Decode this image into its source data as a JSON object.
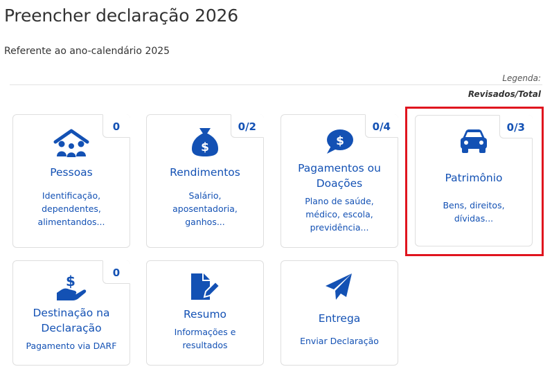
{
  "page": {
    "title": "Preencher declaração 2026",
    "subtitle": "Referente ao ano-calendário 2025",
    "legend_label": "Legenda:",
    "legend_value": "Revisados/Total"
  },
  "colors": {
    "accent": "#1351b4",
    "highlight": "#e0141e",
    "border": "#dedede"
  },
  "cards": [
    {
      "title": "Pessoas",
      "desc": "Identificação, dependentes, alimentandos...",
      "badge": "0",
      "icon": "family-house-icon"
    },
    {
      "title": "Rendimentos",
      "desc": "Salário, aposentadoria, ganhos...",
      "badge": "0/2",
      "icon": "money-bag-icon"
    },
    {
      "title": "Pagamentos ou Doações",
      "desc": "Plano de saúde, médico, escola, previdência...",
      "badge": "0/4",
      "icon": "dollar-chat-bubble-icon"
    },
    {
      "title": "Patrimônio",
      "desc": "Bens, direitos, dívidas...",
      "badge": "0/3",
      "icon": "car-icon"
    },
    {
      "title": "Destinação na Declaração",
      "desc": "Pagamento via DARF",
      "badge": "0",
      "icon": "hand-dollar-icon"
    },
    {
      "title": "Resumo",
      "desc": "Informações e resultados",
      "icon": "document-edit-icon"
    },
    {
      "title": "Entrega",
      "desc": "Enviar Declaração",
      "icon": "paper-plane-icon"
    }
  ]
}
